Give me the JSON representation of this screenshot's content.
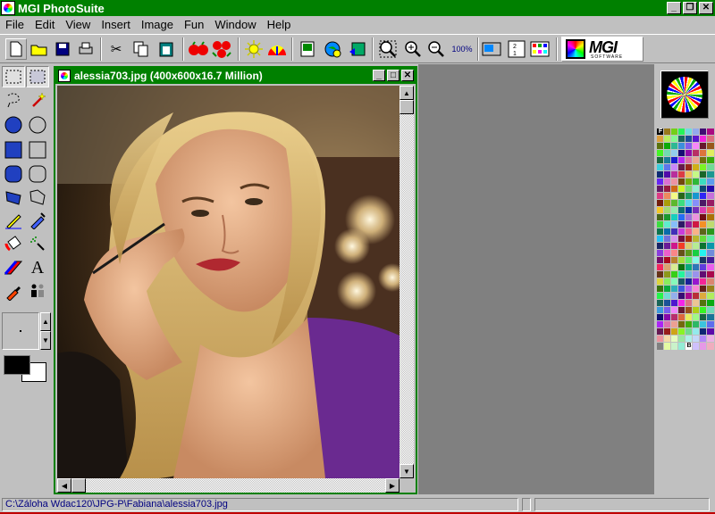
{
  "app": {
    "title": "MGI PhotoSuite",
    "title_color": "#008000"
  },
  "window_controls": {
    "minimize": "_",
    "restore": "❐",
    "close": "✕"
  },
  "menu": [
    "File",
    "Edit",
    "View",
    "Insert",
    "Image",
    "Fun",
    "Window",
    "Help"
  ],
  "toolbar": {
    "zoom_100_label": "100%",
    "logo_text": "MGI",
    "logo_subtext": "SOFTWARE",
    "icons": [
      "new-icon",
      "open-icon",
      "save-icon",
      "print-icon",
      "cut-icon",
      "copy-icon",
      "paste-icon",
      "red-eye-icon",
      "color-icon",
      "brightness-icon",
      "contrast-icon",
      "photo-icon",
      "globe-icon",
      "export-icon",
      "zoom-fit-icon",
      "zoom-in-icon",
      "zoom-out-icon",
      "zoom-100-icon",
      "slideshow-icon",
      "album-icon",
      "calendar-icon"
    ]
  },
  "document": {
    "title": "alessia703.jpg (400x600x16.7 Million)"
  },
  "tools": [
    {
      "name": "rect-select-tool",
      "glyph": "⬚"
    },
    {
      "name": "pointer-select-tool",
      "glyph": "▦"
    },
    {
      "name": "lasso-tool",
      "glyph": "◌"
    },
    {
      "name": "magic-wand-tool",
      "glyph": "✦"
    },
    {
      "name": "filled-circle-tool",
      "glyph": "●"
    },
    {
      "name": "circle-tool",
      "glyph": "○"
    },
    {
      "name": "filled-square-tool",
      "glyph": "■"
    },
    {
      "name": "square-tool",
      "glyph": "□"
    },
    {
      "name": "filled-rounded-rect-tool",
      "glyph": "▮"
    },
    {
      "name": "rounded-rect-tool",
      "glyph": "▯"
    },
    {
      "name": "filled-polygon-tool",
      "glyph": "◆"
    },
    {
      "name": "polygon-tool",
      "glyph": "◇"
    },
    {
      "name": "pencil-tool",
      "glyph": "✎"
    },
    {
      "name": "pen-tool",
      "glyph": "✒"
    },
    {
      "name": "fill-bucket-tool",
      "glyph": "◈"
    },
    {
      "name": "airbrush-tool",
      "glyph": "⁂"
    },
    {
      "name": "eraser-tool",
      "glyph": "⌫"
    },
    {
      "name": "text-tool",
      "glyph": "A"
    },
    {
      "name": "eyedropper-tool",
      "glyph": "⚲"
    },
    {
      "name": "clone-tool",
      "glyph": "⚇"
    }
  ],
  "colors": {
    "foreground": "#000000",
    "background": "#ffffff",
    "workspace": "#808080",
    "palette_markers": {
      "top_left": "F",
      "bottom": "B"
    }
  },
  "status": {
    "path": "C:\\Záloha Wdac120\\JPG-P\\Fabiana\\alessia703.jpg",
    "pane2": "",
    "pane3": ""
  }
}
